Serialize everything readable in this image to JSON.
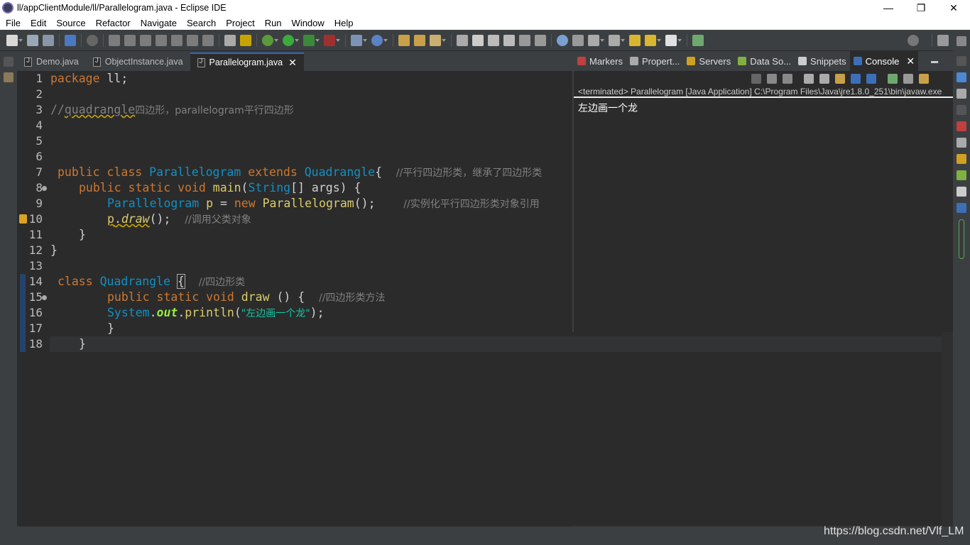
{
  "window": {
    "title": "ll/appClientModule/ll/Parallelogram.java - Eclipse IDE",
    "controls": [
      "—",
      "❐",
      "✕"
    ]
  },
  "menu": [
    "File",
    "Edit",
    "Source",
    "Refactor",
    "Navigate",
    "Search",
    "Project",
    "Run",
    "Window",
    "Help"
  ],
  "editor": {
    "tabs": [
      {
        "label": "Demo.java",
        "active": false
      },
      {
        "label": "ObjectInstance.java",
        "active": false
      },
      {
        "label": "Parallelogram.java",
        "active": true
      }
    ],
    "line_numbers": [
      "1",
      "2",
      "3",
      "4",
      "5",
      "6",
      "7",
      "8",
      "9",
      "10",
      "11",
      "12",
      "13",
      "14",
      "15",
      "16",
      "17",
      "18"
    ],
    "code": {
      "l1": {
        "kw": "package",
        "rest": " ll;"
      },
      "l3": {
        "comment_a": "//",
        "comment_b": "quadrangle",
        "comment_c": "四边形，parallelogram平行四边形"
      },
      "l7": {
        "kw1": "public",
        "kw2": "class",
        "type1": "Parallelogram",
        "kw3": "extends",
        "type2": "Quadrangle",
        "brace": "{",
        "comment": "//平行四边形类，继承了四边形类"
      },
      "l8": {
        "kw1": "public",
        "kw2": "static",
        "kw3": "void",
        "method": "main",
        "p1": "(",
        "type": "String",
        "p2": "[] ",
        "arg": "args",
        "p3": ") {"
      },
      "l9": {
        "type1": "Parallelogram",
        "var": "p",
        "eq": " = ",
        "kw": "new",
        "type2": "Parallelogram",
        "end": "();",
        "comment": "//实例化平行四边形类对象引用"
      },
      "l10": {
        "var": "p",
        "dot": ".",
        "method": "draw",
        "end": "();",
        "comment": "//调用父类对象"
      },
      "l11": {
        "brace": "}"
      },
      "l12": {
        "brace": "}"
      },
      "l14": {
        "kw": "class",
        "type": "Quadrangle",
        "brace": "{",
        "comment": "//四边形类"
      },
      "l15": {
        "kw1": "public",
        "kw2": "static",
        "kw3": "void",
        "method": "draw",
        "end": " () {",
        "comment": "//四边形类方法"
      },
      "l16": {
        "type": "System",
        "dot1": ".",
        "field": "out",
        "dot2": ".",
        "method": "println",
        "p1": "(",
        "str": "\"左边画一个龙\"",
        "p2": ");"
      },
      "l17": {
        "brace": "}"
      },
      "l18": {
        "brace": "}"
      }
    }
  },
  "views": {
    "tabs": [
      "Markers",
      "Propert...",
      "Servers",
      "Data So...",
      "Snippets",
      "Console"
    ],
    "active": "Console"
  },
  "console": {
    "header": "<terminated> Parallelogram [Java Application] C:\\Program Files\\Java\\jre1.8.0_251\\bin\\javaw.exe",
    "output": "左边画一个龙"
  },
  "watermark": "https://blog.csdn.net/Vlf_LM",
  "colors": {
    "keyword": "#cc7832",
    "type": "#1290c3",
    "method": "#dbcc6a",
    "string": "#17c6a3",
    "comment": "#808080",
    "accent": "#2f65ca"
  }
}
